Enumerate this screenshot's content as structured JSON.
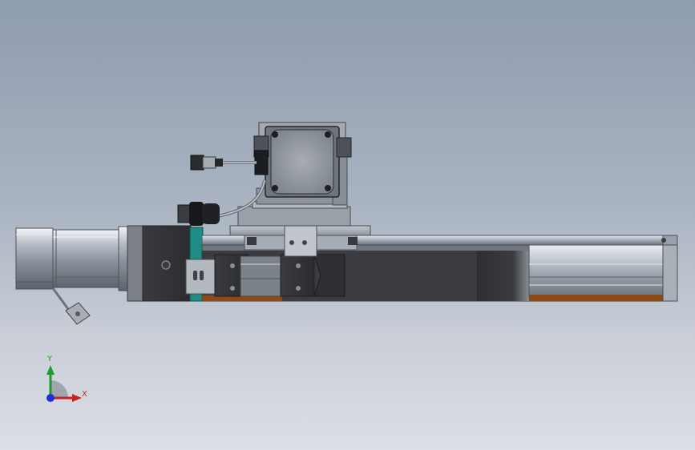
{
  "viewport": {
    "background_top": "#8f9caf",
    "background_bottom": "#dcdfe5"
  },
  "triad": {
    "x_label": "X",
    "y_label": "Y",
    "x_color": "#c82222",
    "y_color": "#1f9a2c",
    "z_color": "#1f2fd0"
  },
  "model": {
    "icons": [
      "servo-motor-icon",
      "linear-rail-icon",
      "gripper-carriage-icon",
      "cable-connector-icon",
      "rotary-motor-icon"
    ]
  }
}
